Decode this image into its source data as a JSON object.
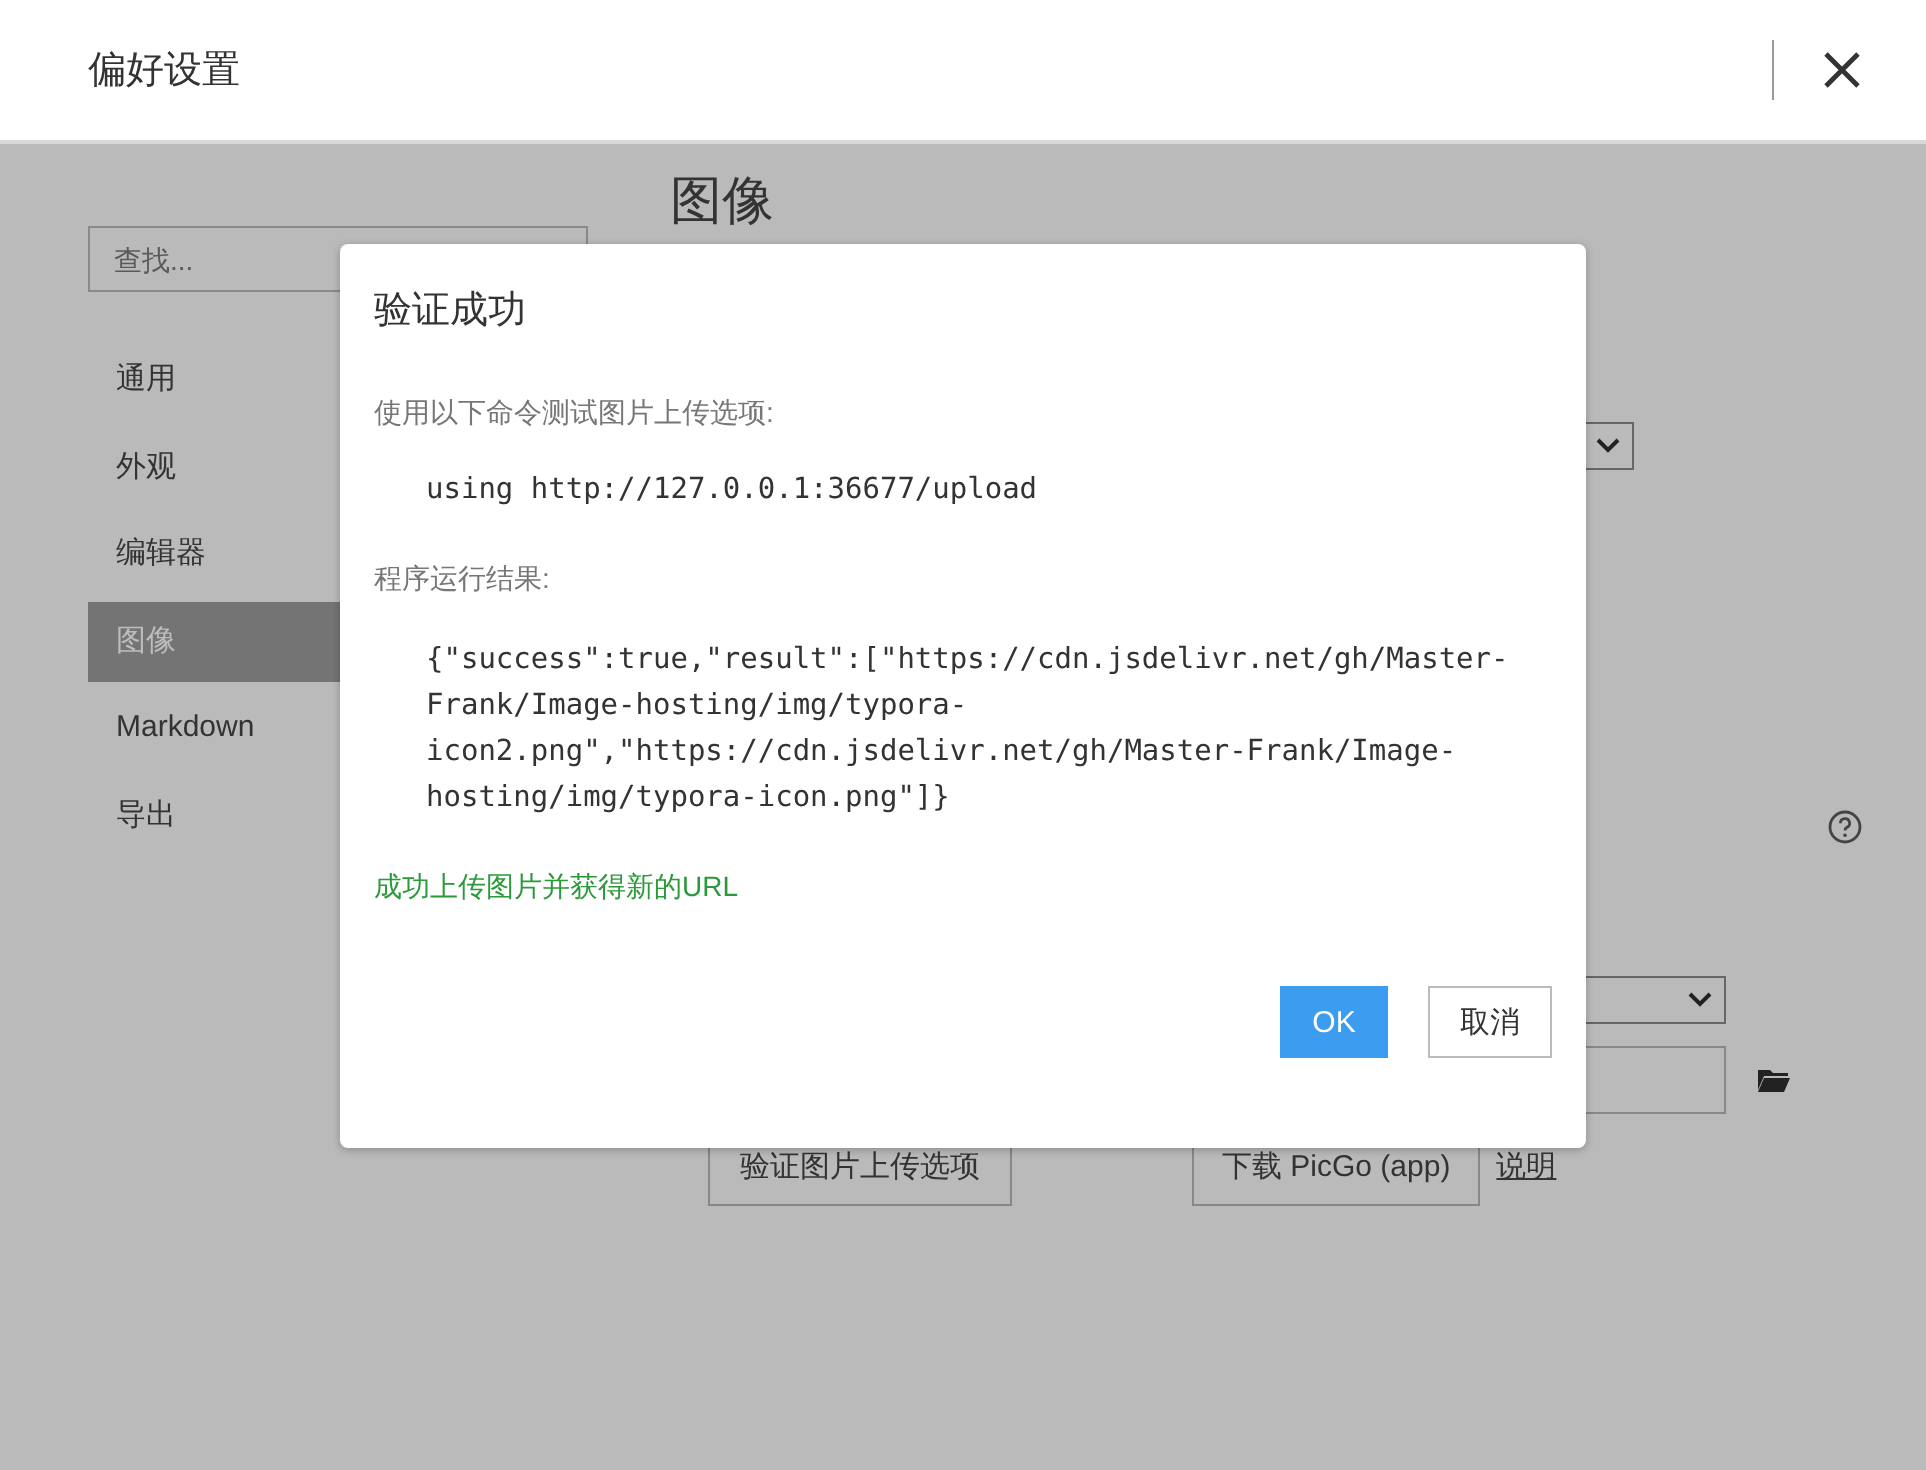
{
  "window": {
    "title": "偏好设置"
  },
  "search": {
    "placeholder": "查找..."
  },
  "sidebar": {
    "items": [
      {
        "label": "通用",
        "selected": false
      },
      {
        "label": "外观",
        "selected": false
      },
      {
        "label": "编辑器",
        "selected": false
      },
      {
        "label": "图像",
        "selected": true
      },
      {
        "label": "Markdown",
        "selected": false
      },
      {
        "label": "导出",
        "selected": false
      }
    ]
  },
  "page": {
    "heading": "图像",
    "buttons": [
      {
        "label": "验证图片上传选项"
      },
      {
        "label": "下载 PicGo (app)"
      }
    ],
    "link": "说明"
  },
  "dialog": {
    "title": "验证成功",
    "prompt": "使用以下命令测试图片上传选项:",
    "command": "using http://127.0.0.1:36677/upload",
    "result_label": "程序运行结果:",
    "result": "{\"success\":true,\"result\":[\"https://cdn.jsdelivr.net/gh/Master-Frank/Image-hosting/img/typora-icon2.png\",\"https://cdn.jsdelivr.net/gh/Master-Frank/Image-hosting/img/typora-icon.png\"]}",
    "message": "成功上传图片并获得新的URL",
    "ok": "OK",
    "cancel": "取消"
  }
}
